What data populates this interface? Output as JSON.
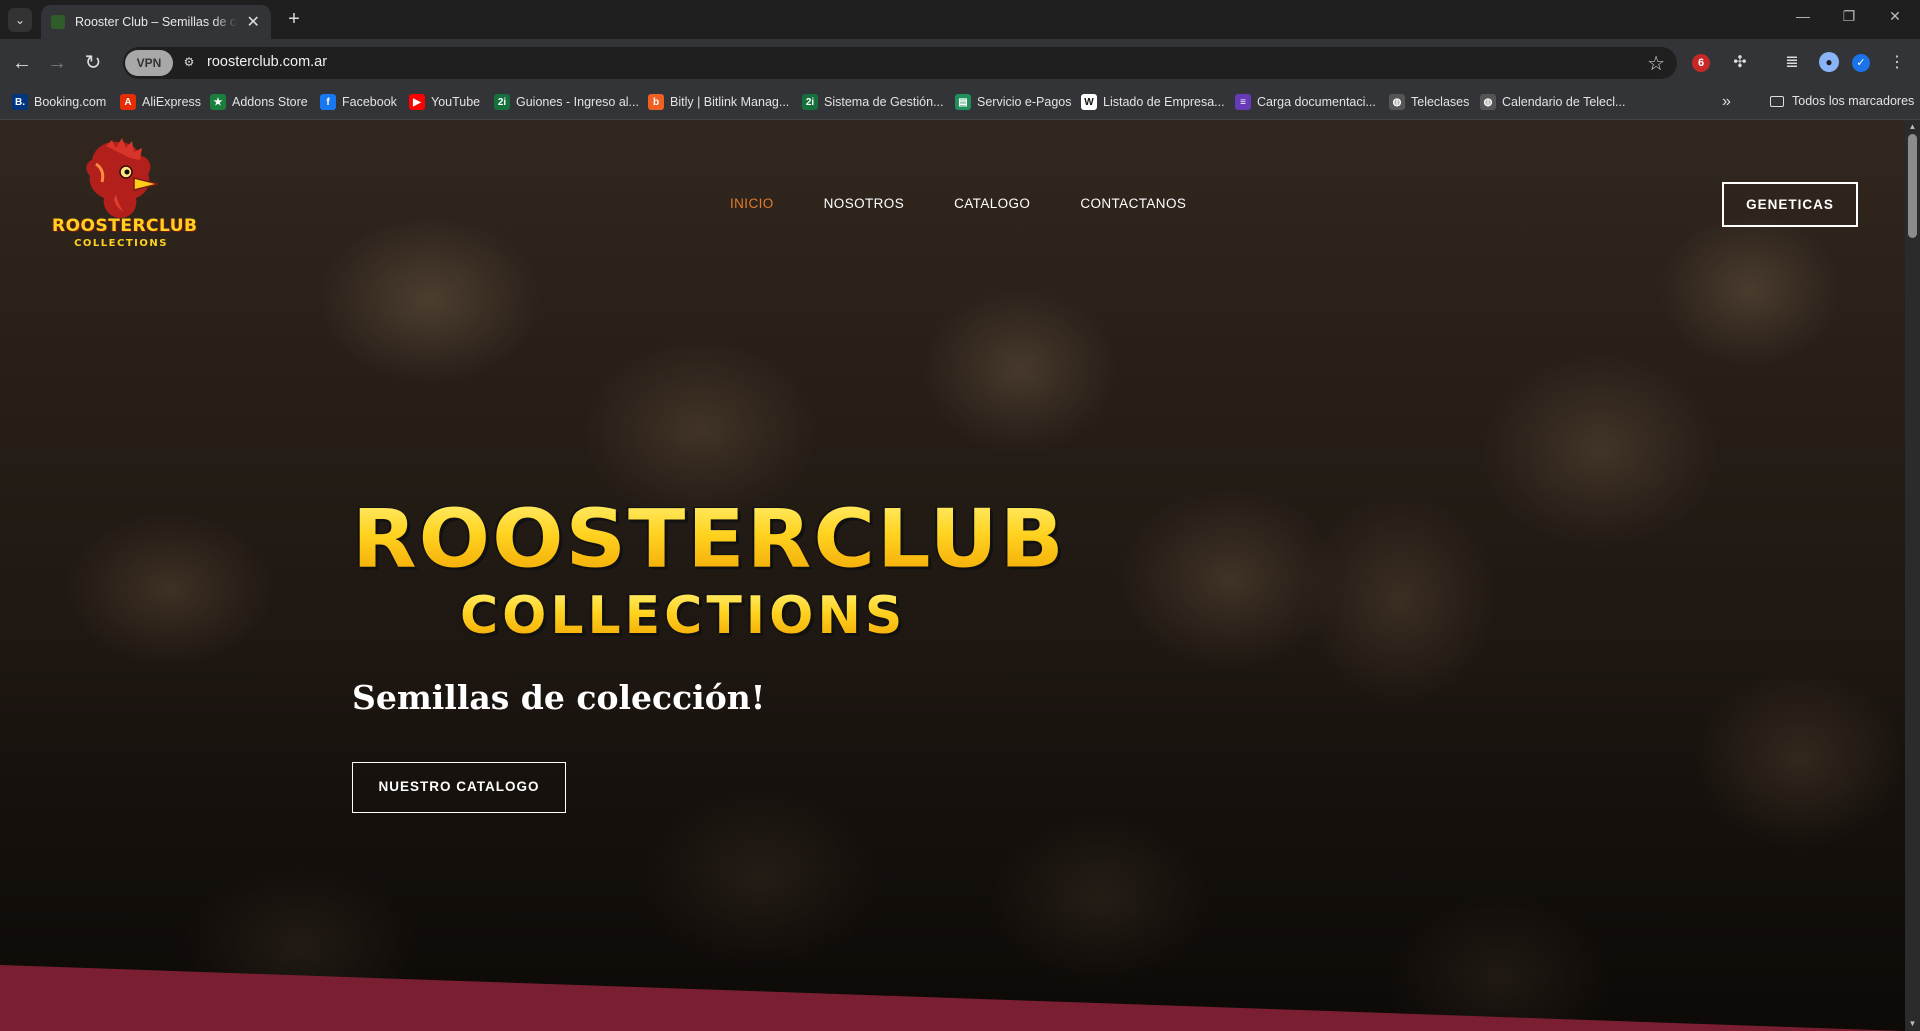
{
  "browser": {
    "tab_title": "Rooster Club – Semillas de colección",
    "url": "roosterclub.com.ar",
    "vpn_label": "VPN",
    "notification_count": "6",
    "bookmarks": [
      {
        "label": "Booking.com",
        "icon": "booking-icon",
        "color": "#003580",
        "glyph": "B."
      },
      {
        "label": "AliExpress",
        "icon": "aliexpress-icon",
        "color": "#e62e04",
        "glyph": "A"
      },
      {
        "label": "Addons Store",
        "icon": "addons-store-icon",
        "color": "#1a7f3c",
        "glyph": "★"
      },
      {
        "label": "Facebook",
        "icon": "facebook-icon",
        "color": "#1877f2",
        "glyph": "f"
      },
      {
        "label": "YouTube",
        "icon": "youtube-icon",
        "color": "#ff0000",
        "glyph": "▶"
      },
      {
        "label": "Guiones - Ingreso al...",
        "icon": "guiones-icon",
        "color": "#16703b",
        "glyph": "2i"
      },
      {
        "label": "Bitly | Bitlink Manag...",
        "icon": "bitly-icon",
        "color": "#ee6123",
        "glyph": "b"
      },
      {
        "label": "Sistema de Gestión...",
        "icon": "sistema-gestion-icon",
        "color": "#16703b",
        "glyph": "2i"
      },
      {
        "label": "Servicio e-Pagos",
        "icon": "epagos-icon",
        "color": "#1f8f5c",
        "glyph": "▤"
      },
      {
        "label": "Listado de Empresa...",
        "icon": "wix-icon",
        "color": "#ffffff",
        "glyph": "W"
      },
      {
        "label": "Carga documentaci...",
        "icon": "forms-icon",
        "color": "#673ab7",
        "glyph": "≡"
      },
      {
        "label": "Teleclases",
        "icon": "globe-icon",
        "color": "#555555",
        "glyph": "◍"
      },
      {
        "label": "Calendario de Telecl...",
        "icon": "globe-icon",
        "color": "#555555",
        "glyph": "◍"
      }
    ],
    "all_bookmarks_label": "Todos los marcadores"
  },
  "site": {
    "logo_name": "ROOSTERCLUB",
    "logo_sub": "COLLECTIONS",
    "nav": [
      "INICIO",
      "NOSOTROS",
      "CATALOGO",
      "CONTACTANOS"
    ],
    "cta_top": "GENETICAS",
    "hero_title_line1": "ROOSTERCLUB",
    "hero_title_line2": "COLLECTIONS",
    "hero_tagline": "Semillas de colección!",
    "hero_button": "NUESTRO CATALOGO",
    "accent_color": "#e37b2b",
    "brand_yellow": "#ffd21f",
    "wedge_color": "#7a1f32"
  }
}
